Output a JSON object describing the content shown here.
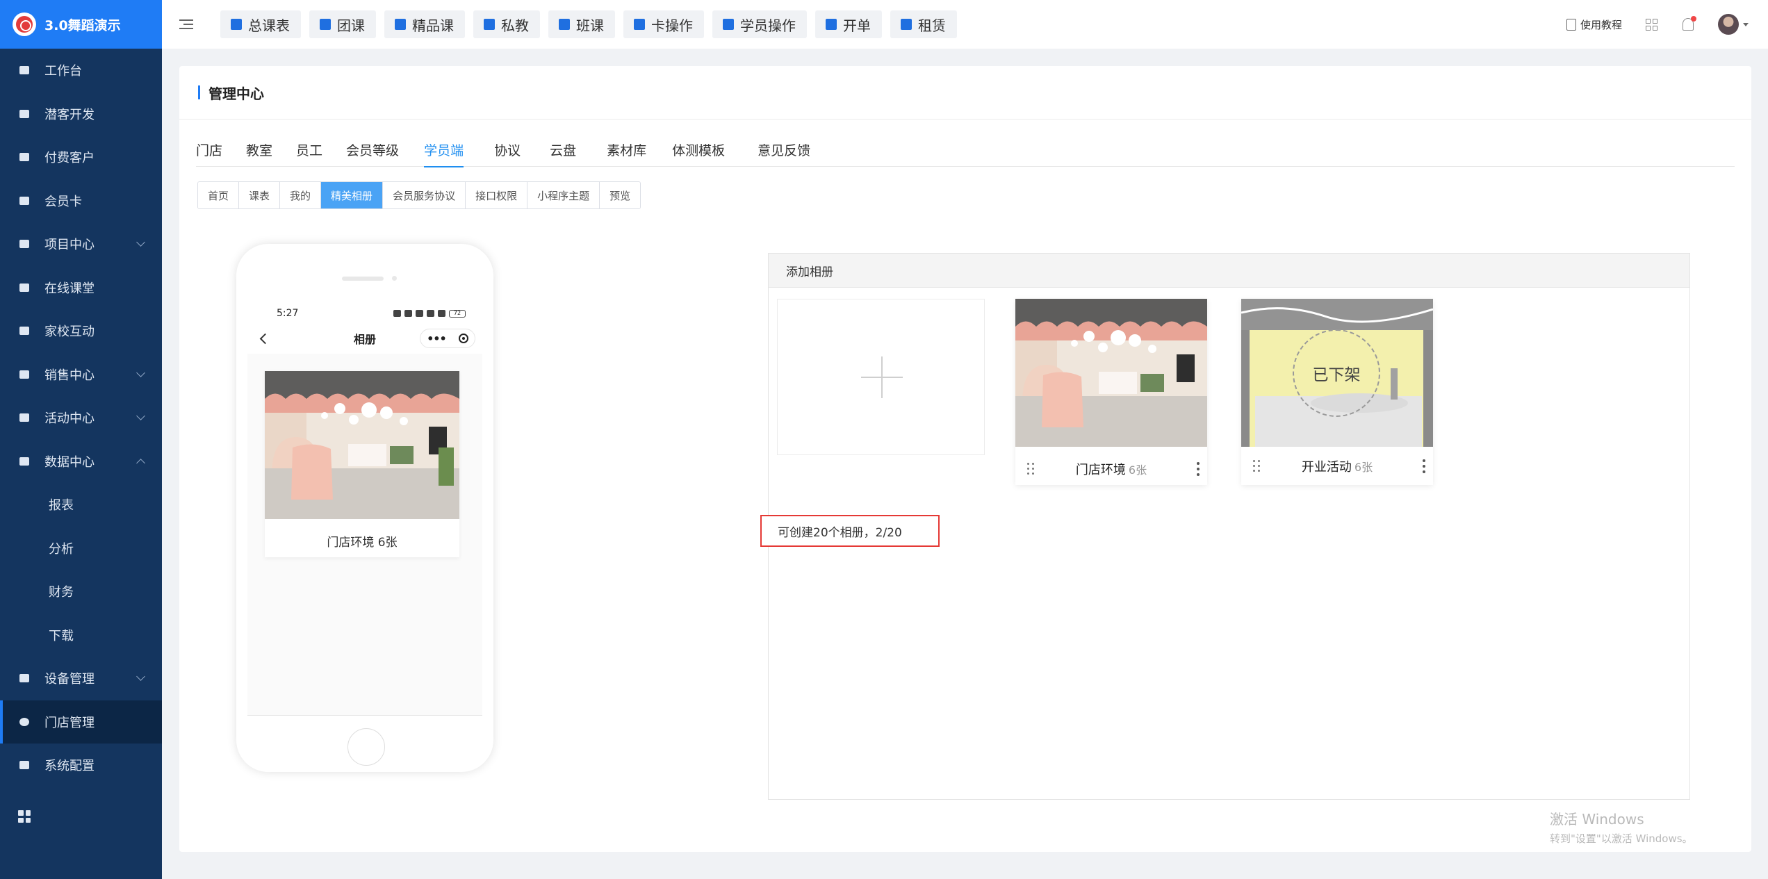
{
  "brand": {
    "title": "3.0舞蹈演示"
  },
  "sidebar": {
    "items": [
      {
        "label": "工作台",
        "icon": "image-icon"
      },
      {
        "label": "潜客开发",
        "icon": "id-card-icon"
      },
      {
        "label": "付费客户",
        "icon": "users-icon"
      },
      {
        "label": "会员卡",
        "icon": "card-icon"
      },
      {
        "label": "项目中心",
        "icon": "list-icon",
        "expandable": true
      },
      {
        "label": "在线课堂",
        "icon": "camera-icon"
      },
      {
        "label": "家校互动",
        "icon": "contact-icon"
      },
      {
        "label": "销售中心",
        "icon": "tag-icon",
        "expandable": true
      },
      {
        "label": "活动中心",
        "icon": "activity-icon",
        "expandable": true
      },
      {
        "label": "数据中心",
        "icon": "pie-chart-icon",
        "expanded": true
      }
    ],
    "data_children": [
      "报表",
      "分析",
      "财务",
      "下载"
    ],
    "items_after": [
      {
        "label": "设备管理",
        "icon": "device-icon",
        "expandable": true
      },
      {
        "label": "门店管理",
        "icon": "store-icon",
        "active": true
      },
      {
        "label": "系统配置",
        "icon": "settings-icon"
      }
    ]
  },
  "topnav": [
    "总课表",
    "团课",
    "精品课",
    "私教",
    "班课",
    "卡操作",
    "学员操作",
    "开单",
    "租赁"
  ],
  "topright": {
    "help_label": "使用教程"
  },
  "page": {
    "title": "管理中心",
    "tabs": [
      "门店",
      "教室",
      "员工",
      "会员等级",
      "学员端",
      "协议",
      "云盘",
      "素材库",
      "体测模板",
      "意见反馈"
    ],
    "active_tab": "学员端",
    "subtabs": [
      "首页",
      "课表",
      "我的",
      "精美相册",
      "会员服务协议",
      "接口权限",
      "小程序主题",
      "预览"
    ],
    "active_subtab": "精美相册"
  },
  "phone": {
    "time": "5:27",
    "battery": "72",
    "nav_title": "相册",
    "album_caption": "门店环境 6张"
  },
  "album_panel": {
    "header": "添加相册",
    "hint": "可创建20个相册，2/20",
    "albums": [
      {
        "name": "门店环境",
        "count": "6张",
        "status": ""
      },
      {
        "name": "开业活动",
        "count": "6张",
        "status": "已下架"
      }
    ]
  },
  "watermark": {
    "line1": "激活 Windows",
    "line2": "转到\"设置\"以激活 Windows。"
  },
  "colors": {
    "sidebar_bg": "#14355f",
    "brand_bg": "#1f7cf5",
    "accent": "#1f8ef0",
    "subtab_active": "#4aa3f5",
    "highlight_border": "#e53935"
  }
}
